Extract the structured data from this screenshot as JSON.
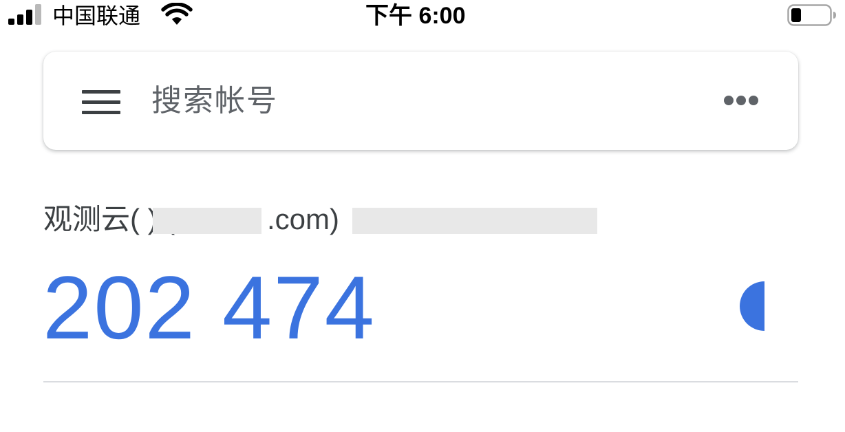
{
  "status_bar": {
    "carrier": "中国联通",
    "time": "下午 6:00"
  },
  "search": {
    "placeholder": "搜索帐号"
  },
  "account": {
    "label": "观测云(        ) (chu                  @                         .com)",
    "code": "202 474",
    "timer_fraction_remaining": 0.5
  },
  "icons": {
    "menu": "hamburger-menu-icon",
    "more": "more-horizontal-icon",
    "timer": "countdown-timer-icon",
    "wifi": "wifi-icon",
    "battery": "battery-icon",
    "signal": "cellular-signal-icon"
  },
  "colors": {
    "accent": "#3b73df",
    "icon": "#5f6368",
    "text": "#3c4043",
    "divider": "#dadce0"
  }
}
